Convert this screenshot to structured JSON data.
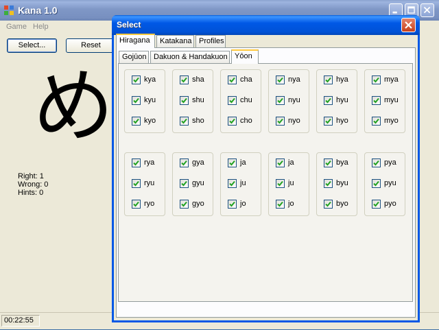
{
  "window": {
    "title": "Kana 1.0"
  },
  "menu": {
    "game": "Game",
    "help": "Help"
  },
  "toolbar": {
    "select_label": "Select...",
    "reset_label": "Reset"
  },
  "current_kana": "め",
  "stats": {
    "right": "Right: 1",
    "wrong": "Wrong: 0",
    "hints": "Hints: 0"
  },
  "status": {
    "time": "00:22:55"
  },
  "dialog": {
    "title": "Select",
    "tabs": [
      "Hiragana",
      "Katakana",
      "Profiles"
    ],
    "active_tab": "Hiragana",
    "sub_tabs": [
      "Gojūon",
      "Dakuon & Handakuon",
      "Yōon"
    ],
    "active_sub_tab": "Yōon",
    "groups": [
      {
        "items": [
          {
            "label": "kya",
            "checked": true
          },
          {
            "label": "kyu",
            "checked": true
          },
          {
            "label": "kyo",
            "checked": true
          }
        ]
      },
      {
        "items": [
          {
            "label": "sha",
            "checked": true
          },
          {
            "label": "shu",
            "checked": true
          },
          {
            "label": "sho",
            "checked": true
          }
        ]
      },
      {
        "items": [
          {
            "label": "cha",
            "checked": true
          },
          {
            "label": "chu",
            "checked": true
          },
          {
            "label": "cho",
            "checked": true
          }
        ]
      },
      {
        "items": [
          {
            "label": "nya",
            "checked": true
          },
          {
            "label": "nyu",
            "checked": true
          },
          {
            "label": "nyo",
            "checked": true
          }
        ]
      },
      {
        "items": [
          {
            "label": "hya",
            "checked": true
          },
          {
            "label": "hyu",
            "checked": true
          },
          {
            "label": "hyo",
            "checked": true
          }
        ]
      },
      {
        "items": [
          {
            "label": "mya",
            "checked": true
          },
          {
            "label": "myu",
            "checked": true
          },
          {
            "label": "myo",
            "checked": true
          }
        ]
      },
      {
        "items": [
          {
            "label": "rya",
            "checked": true
          },
          {
            "label": "ryu",
            "checked": true
          },
          {
            "label": "ryo",
            "checked": true
          }
        ]
      },
      {
        "items": [
          {
            "label": "gya",
            "checked": true
          },
          {
            "label": "gyu",
            "checked": true
          },
          {
            "label": "gyo",
            "checked": true
          }
        ]
      },
      {
        "items": [
          {
            "label": "ja",
            "checked": true
          },
          {
            "label": "ju",
            "checked": true
          },
          {
            "label": "jo",
            "checked": true
          }
        ]
      },
      {
        "items": [
          {
            "label": "ja",
            "checked": true
          },
          {
            "label": "ju",
            "checked": true
          },
          {
            "label": "jo",
            "checked": true
          }
        ]
      },
      {
        "items": [
          {
            "label": "bya",
            "checked": true
          },
          {
            "label": "byu",
            "checked": true
          },
          {
            "label": "byo",
            "checked": true
          }
        ]
      },
      {
        "items": [
          {
            "label": "pya",
            "checked": true
          },
          {
            "label": "pyu",
            "checked": true
          },
          {
            "label": "pyo",
            "checked": true
          }
        ]
      }
    ]
  },
  "colors": {
    "checkmark": "#21a121",
    "title_active": "#0058e6",
    "title_inactive": "#7f97c6",
    "tab_highlight": "#ffc83c"
  }
}
